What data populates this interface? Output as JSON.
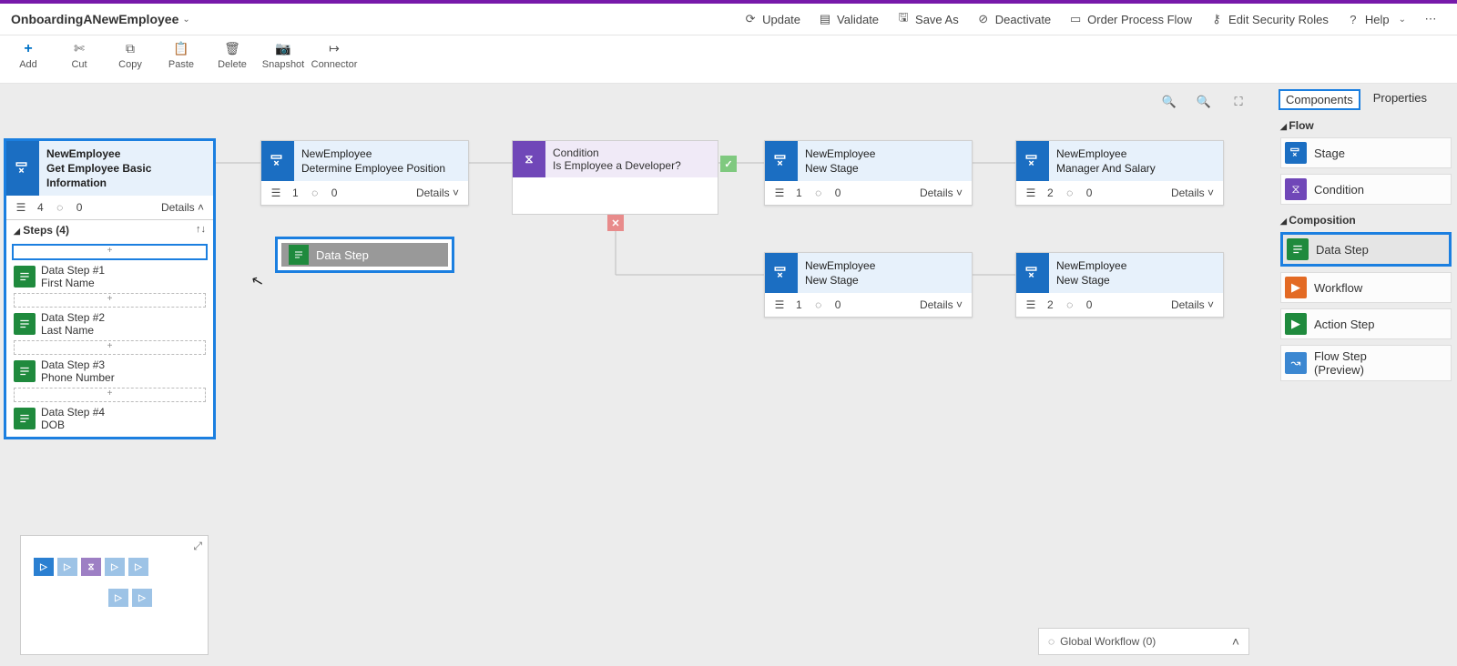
{
  "header": {
    "title": "OnboardingANewEmployee",
    "actions": {
      "update": "Update",
      "validate": "Validate",
      "save_as": "Save As",
      "deactivate": "Deactivate",
      "order": "Order Process Flow",
      "security": "Edit Security Roles",
      "help": "Help"
    }
  },
  "toolbar": {
    "add": "Add",
    "cut": "Cut",
    "copy": "Copy",
    "paste": "Paste",
    "delete": "Delete",
    "snapshot": "Snapshot",
    "connector": "Connector"
  },
  "canvas": {
    "stages": {
      "s1": {
        "entity": "NewEmployee",
        "name": "Get Employee Basic Information",
        "steps": "4",
        "flows": "0",
        "details": "Details"
      },
      "s2": {
        "entity": "NewEmployee",
        "name": "Determine Employee Position",
        "steps": "1",
        "flows": "0",
        "details": "Details"
      },
      "s3": {
        "entity": "NewEmployee",
        "name": "New Stage",
        "steps": "1",
        "flows": "0",
        "details": "Details"
      },
      "s4": {
        "entity": "NewEmployee",
        "name": "Manager And Salary",
        "steps": "2",
        "flows": "0",
        "details": "Details"
      },
      "s5": {
        "entity": "NewEmployee",
        "name": "New Stage",
        "steps": "1",
        "flows": "0",
        "details": "Details"
      },
      "s6": {
        "entity": "NewEmployee",
        "name": "New Stage",
        "steps": "2",
        "flows": "0",
        "details": "Details"
      }
    },
    "condition": {
      "type": "Condition",
      "name": "Is Employee a Developer?"
    },
    "steps_header": "Steps (4)",
    "step_items": {
      "a": {
        "l1": "Data Step #1",
        "l2": "First Name"
      },
      "b": {
        "l1": "Data Step #2",
        "l2": "Last Name"
      },
      "c": {
        "l1": "Data Step #3",
        "l2": "Phone Number"
      },
      "d": {
        "l1": "Data Step #4",
        "l2": "DOB"
      }
    },
    "drag_label": "Data Step",
    "global_workflow": "Global Workflow (0)"
  },
  "rpanel": {
    "tabs": {
      "components": "Components",
      "properties": "Properties"
    },
    "sections": {
      "flow": "Flow",
      "composition": "Composition"
    },
    "items": {
      "stage": "Stage",
      "condition": "Condition",
      "data_step": "Data Step",
      "workflow": "Workflow",
      "action_step": "Action Step",
      "flow_step_l1": "Flow Step",
      "flow_step_l2": "(Preview)"
    }
  },
  "colors": {
    "blue": "#1b6ec2",
    "purple": "#7047b8",
    "green": "#1f8a3d",
    "orange": "#e36a24",
    "flow_blue": "#3b87d1"
  }
}
